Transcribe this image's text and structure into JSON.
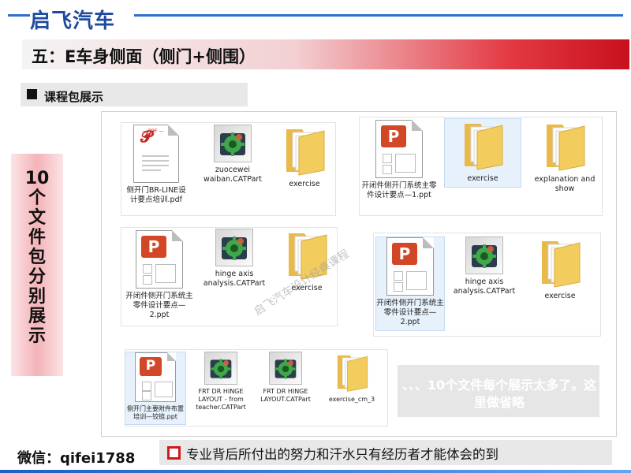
{
  "header": {
    "brand": "启飞汽车",
    "title": "五：E车身侧面（侧门+侧围）"
  },
  "section": {
    "label": "课程包展示"
  },
  "side_banner": {
    "text": "10个文件包分别展示"
  },
  "panel": {
    "groups": [
      {
        "items": [
          {
            "type": "pdf",
            "label": "侧开门BR-LINE设计要点培训.pdf"
          },
          {
            "type": "catpart",
            "label": "zuocewei waiban.CATPart"
          },
          {
            "type": "folder",
            "label": "exercise"
          }
        ]
      },
      {
        "items": [
          {
            "type": "ppt",
            "label": "开闭件侧开门系统主零件设计要点—1.ppt"
          },
          {
            "type": "folder",
            "label": "exercise"
          },
          {
            "type": "folder",
            "label": "explanation and show"
          }
        ]
      },
      {
        "items": [
          {
            "type": "ppt",
            "label": "开闭件侧开门系统主零件设计要点—2.ppt"
          },
          {
            "type": "catpart",
            "label": "hinge axis analysis.CATPart"
          },
          {
            "type": "folder",
            "label": "exercise"
          }
        ]
      },
      {
        "items": [
          {
            "type": "ppt",
            "label": "开闭件侧开门系统主零件设计要点—2.ppt"
          },
          {
            "type": "catpart",
            "label": "hinge axis analysis.CATPart"
          },
          {
            "type": "folder",
            "label": "exercise"
          }
        ]
      },
      {
        "items": [
          {
            "type": "ppt",
            "label": "侧开门主要附件布置培训—铰链.ppt"
          },
          {
            "type": "catpart",
            "label": "FRT DR HINGE LAYOUT - from teacher.CATPart"
          },
          {
            "type": "catpart",
            "label": "FRT DR HINGE LAYOUT.CATPart"
          },
          {
            "type": "folder",
            "label": "exercise_cm_3"
          }
        ]
      }
    ],
    "watermark": "启飞汽车设计经典课程"
  },
  "note": {
    "text": "、、、10个文件每个展示太多了。这里做省略"
  },
  "footer": {
    "wechat": "微信：qifei1788",
    "motto": "专业背后所付出的努力和汗水只有经历者才能体会的到"
  },
  "colors": {
    "brand_blue": "#1f4aa0",
    "title_red": "#c8101d",
    "ppt_orange": "#d24726",
    "pdf_red": "#c62828",
    "folder_yellow": "#f3cc5e"
  }
}
